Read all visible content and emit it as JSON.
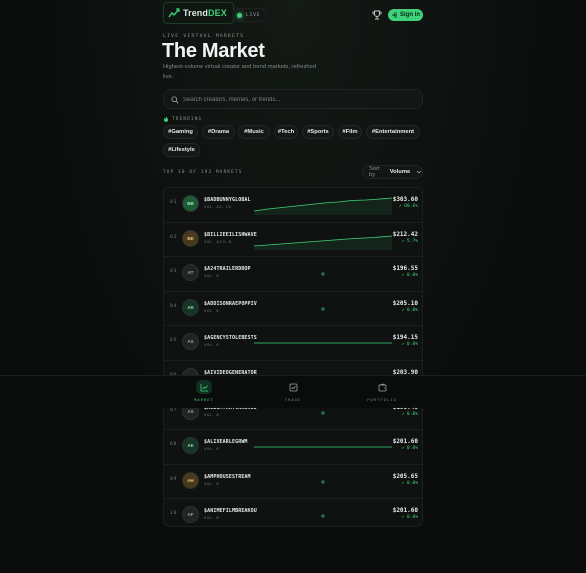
{
  "header": {
    "logo_text": "Trend",
    "logo_accent": "DEX",
    "live_label": "LIVE",
    "signin_label": "Sign in"
  },
  "hero": {
    "eyebrow": "LIVE VIRTUAL MARKETS",
    "title": "The Market",
    "subtitle": "Highest-volume virtual creator and trend markets, refreshed live."
  },
  "search": {
    "placeholder": "Search creators, memes, or trends..."
  },
  "trending": {
    "label": "TRENDING",
    "tags": [
      "#Gaming",
      "#Drama",
      "#Music",
      "#Tech",
      "#Sports",
      "#Film",
      "#Entertainment",
      "#Lifestyle"
    ]
  },
  "list": {
    "heading": "TOP 10 OF 193 MARKETS",
    "sort_label": "Sort by",
    "sort_value": "Volume"
  },
  "markets": [
    {
      "rank": "01",
      "initials": "BB",
      "symbol": "$BADBUNNYGLOBAL",
      "volume": "VOL $2.1K",
      "price": "$303.60",
      "change": "80.6%",
      "avatar_color": "#1f5a36",
      "avatar_text": "#9be7b8",
      "spark": "trend-up-strong"
    },
    {
      "rank": "02",
      "initials": "BE",
      "symbol": "$BILLIEEILISHWAVE",
      "volume": "VOL $23.8",
      "price": "$212.42",
      "change": "5.7%",
      "avatar_color": "#4a3a1c",
      "avatar_text": "#e8c98a",
      "spark": "trend-up"
    },
    {
      "rank": "03",
      "initials": "AT",
      "symbol": "$A24TRAILERDROP",
      "volume": "VOL 0",
      "price": "$196.55",
      "change": "0.0%",
      "avatar_color": "#1e2523",
      "avatar_text": "#9aa6a0",
      "spark": "dot"
    },
    {
      "rank": "04",
      "initials": "AR",
      "symbol": "$ADDISONRAEPOPPIV",
      "volume": "VOL 0",
      "price": "$205.10",
      "change": "0.0%",
      "avatar_color": "#173526",
      "avatar_text": "#8fd6ad",
      "spark": "dot"
    },
    {
      "rank": "05",
      "initials": "AS",
      "symbol": "$AGENCYSTOLEBESTS",
      "volume": "VOL 0",
      "price": "$194.15",
      "change": "0.0%",
      "avatar_color": "#1e2523",
      "avatar_text": "#9aa6a0",
      "spark": "flat"
    },
    {
      "rank": "06",
      "initials": "AI",
      "symbol": "$AIVIDEOGENERATOR",
      "volume": "VOL 0",
      "price": "$203.90",
      "change": "0.0%",
      "avatar_color": "#1e2523",
      "avatar_text": "#9aa6a0",
      "spark": "dot"
    },
    {
      "rank": "07",
      "initials": "AS",
      "symbol": "$ALBUMTHATCRASHED",
      "volume": "VOL 0",
      "price": "$198.40",
      "change": "0.0%",
      "avatar_color": "#1e2523",
      "avatar_text": "#9aa6a0",
      "spark": "dot"
    },
    {
      "rank": "08",
      "initials": "AE",
      "symbol": "$ALIXEARLEGRWM",
      "volume": "VOL 0",
      "price": "$201.60",
      "change": "0.0%",
      "avatar_color": "#173526",
      "avatar_text": "#8fd6ad",
      "spark": "flat"
    },
    {
      "rank": "09",
      "initials": "AH",
      "symbol": "$AMPHOUSESTREAM",
      "volume": "VOL 0",
      "price": "$205.65",
      "change": "0.0%",
      "avatar_color": "#4a3a1c",
      "avatar_text": "#e8c98a",
      "spark": "dot"
    },
    {
      "rank": "10",
      "initials": "AF",
      "symbol": "$ANIMEFILMBREAKOU",
      "volume": "VOL 0",
      "price": "$201.60",
      "change": "0.0%",
      "avatar_color": "#1e2523",
      "avatar_text": "#9aa6a0",
      "spark": "dot"
    }
  ],
  "bottom_nav": [
    {
      "label": "MARKET",
      "icon": "chart-icon",
      "active": true
    },
    {
      "label": "TRADE",
      "icon": "trade-icon",
      "active": false
    },
    {
      "label": "PORTFOLIO",
      "icon": "wallet-icon",
      "active": false
    }
  ],
  "colors": {
    "accent": "#3fd27a",
    "background": "#0b0d0c",
    "panel": "#0f1211"
  }
}
